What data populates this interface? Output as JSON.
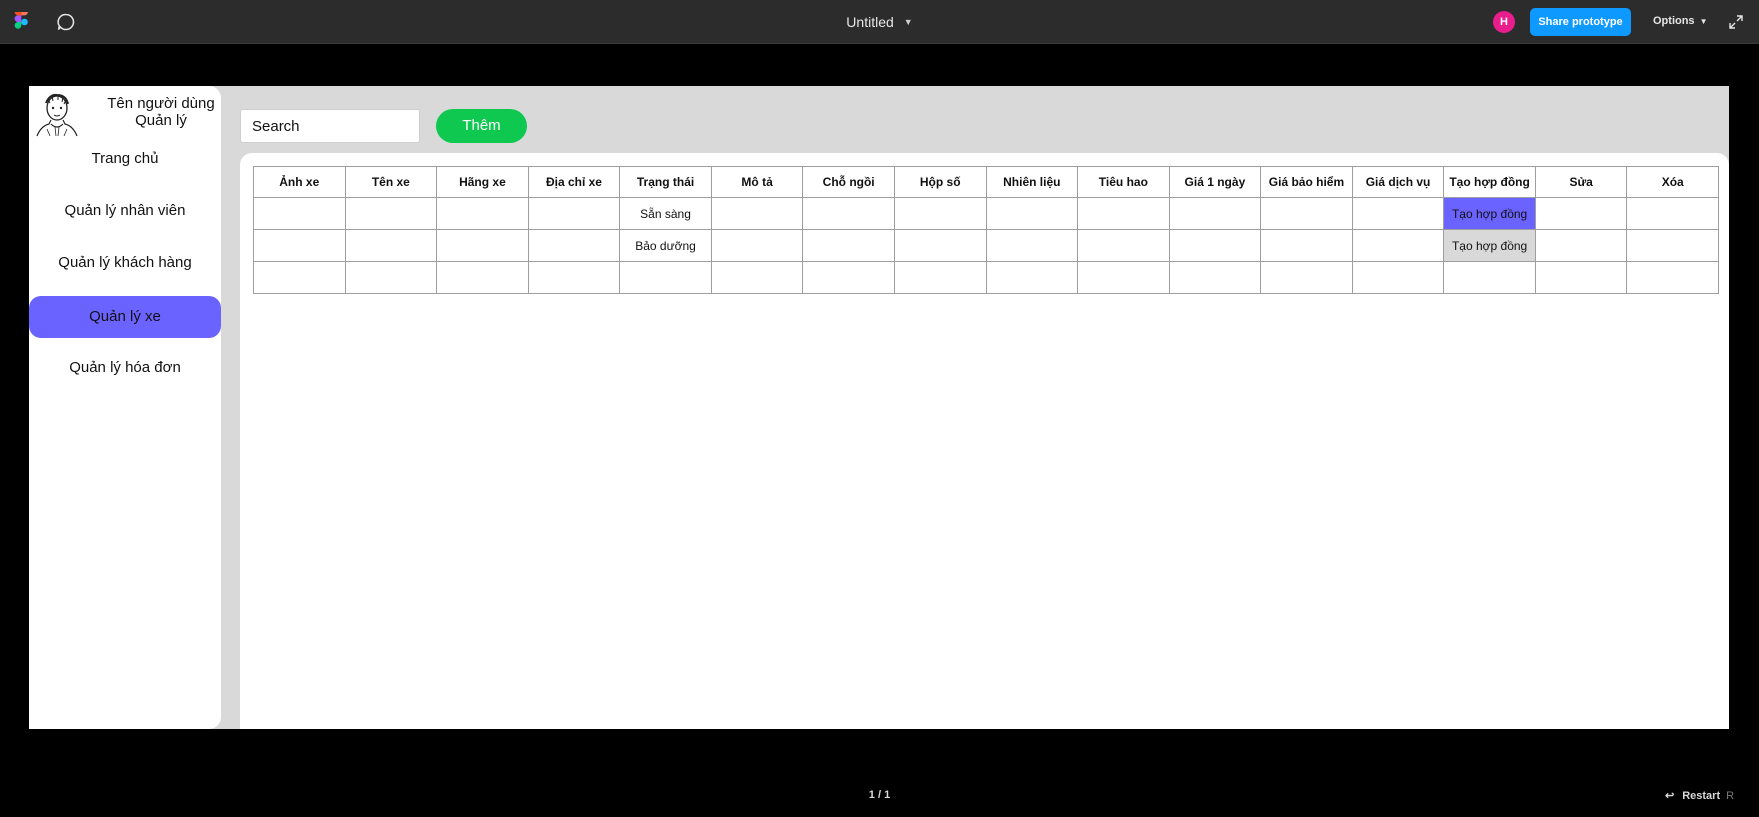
{
  "topbar": {
    "title": "Untitled",
    "avatar_initial": "H",
    "share_label": "Share prototype",
    "options_label": "Options",
    "colors": {
      "bar": "#2c2c2c",
      "share": "#0d99ff",
      "avatar": "#e91e8c"
    }
  },
  "sidebar": {
    "user_name": "Tên người dùng",
    "user_role": "Quản lý",
    "items": [
      {
        "label": "Trang chủ"
      },
      {
        "label": "Quản lý nhân viên"
      },
      {
        "label": "Quản lý khách hàng"
      },
      {
        "label": "Quản lý xe"
      },
      {
        "label": "Quản lý hóa đơn"
      }
    ],
    "active_color": "#6b63ff"
  },
  "toolbar": {
    "search_placeholder": "Search",
    "add_label": "Thêm",
    "add_color": "#0fc850"
  },
  "table": {
    "headers": [
      "Ảnh xe",
      "Tên xe",
      "Hãng xe",
      "Địa chỉ xe",
      "Trạng thái",
      "Mô tả",
      "Chỗ ngồi",
      "Hộp số",
      "Nhiên liệu",
      "Tiêu hao",
      "Giá 1 ngày",
      "Giá bảo hiểm",
      "Giá dịch vụ",
      "Tạo hợp đồng",
      "Sửa",
      "Xóa"
    ],
    "rows": [
      {
        "status": "Sẵn sàng",
        "contract": "Tạo hợp đồng"
      },
      {
        "status": "Bảo dưỡng",
        "contract": "Tạo hợp đồng"
      },
      {
        "status": "",
        "contract": ""
      }
    ]
  },
  "footer": {
    "page": "1 / 1",
    "restart_label": "Restart",
    "restart_key": "R"
  }
}
